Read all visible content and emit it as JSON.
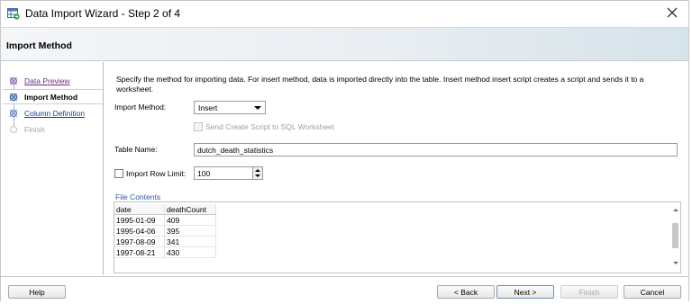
{
  "window": {
    "title": "Data Import Wizard - Step 2 of 4"
  },
  "header": {
    "title": "Import Method"
  },
  "nav": {
    "items": [
      {
        "label": "Data Preview",
        "state": "visited"
      },
      {
        "label": "Import Method",
        "state": "active"
      },
      {
        "label": "Column Definition",
        "state": "link"
      },
      {
        "label": "Finish",
        "state": "disabled"
      }
    ]
  },
  "form": {
    "description": "Specify the method for importing data.  For insert method, data is imported directly into the table.  Insert method insert script creates a script and sends it to a worksheet.",
    "import_method_label": "Import Method:",
    "import_method_value": "Insert",
    "send_script_label": "Send Create Script to SQL Worksheet",
    "send_script_checked": false,
    "table_name_label": "Table Name:",
    "table_name_value": "dutch_death_statistics",
    "row_limit_label": "Import Row Limit:",
    "row_limit_checked": false,
    "row_limit_value": "100"
  },
  "file_contents": {
    "title": "File Contents",
    "columns": [
      "date",
      "deathCount"
    ],
    "rows": [
      [
        "1995-01-09",
        "409"
      ],
      [
        "1995-04-06",
        "395"
      ],
      [
        "1997-08-09",
        "341"
      ],
      [
        "1997-08-21",
        "430"
      ]
    ]
  },
  "buttons": {
    "help": "Help",
    "back": "< Back",
    "next": "Next >",
    "finish": "Finish",
    "cancel": "Cancel"
  },
  "colors": {
    "link": "#1a3e8c",
    "visited_link": "#6b2c8a",
    "section_title": "#2c5aa0",
    "header_gradient_end": "#d6e3ea"
  },
  "icons": {
    "app": "data-import-wizard-icon",
    "close": "close-icon"
  }
}
